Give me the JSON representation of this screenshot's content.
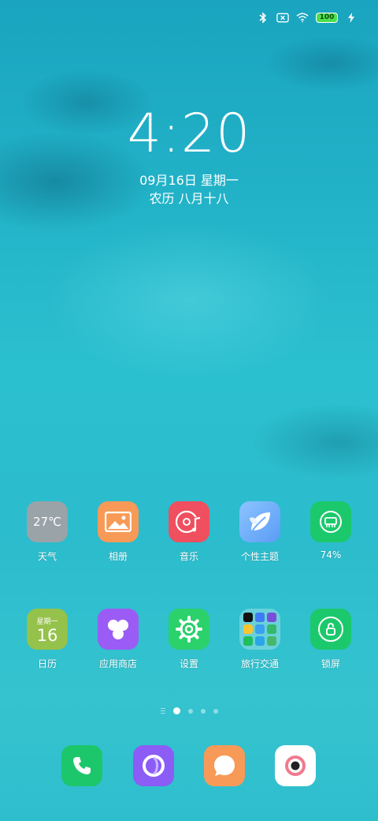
{
  "status": {
    "battery_level": "100",
    "icons": [
      "bluetooth-icon",
      "sim-x-icon",
      "wifi-icon",
      "battery-icon",
      "charging-icon"
    ]
  },
  "lock": {
    "time": "4:20",
    "date": "09月16日 星期一",
    "lunar": "农历 八月十八"
  },
  "row1": [
    {
      "label": "天气",
      "icon": "weather-icon",
      "temp": "27℃"
    },
    {
      "label": "相册",
      "icon": "gallery-icon"
    },
    {
      "label": "音乐",
      "icon": "music-icon"
    },
    {
      "label": "个性主题",
      "icon": "theme-leaf-icon"
    },
    {
      "label": "74%",
      "icon": "storage-cleaner-icon"
    }
  ],
  "row2": [
    {
      "label": "日历",
      "icon": "calendar-icon",
      "weekday": "星期一",
      "day": "16"
    },
    {
      "label": "应用商店",
      "icon": "app-store-icon"
    },
    {
      "label": "设置",
      "icon": "gear-icon"
    },
    {
      "label": "旅行交通",
      "icon": "folder-icon"
    },
    {
      "label": "锁屏",
      "icon": "lock-screen-icon"
    }
  ],
  "pages": {
    "count": 4,
    "active": 1
  },
  "dock": [
    {
      "icon": "phone-icon"
    },
    {
      "icon": "browser-icon"
    },
    {
      "icon": "messages-icon"
    },
    {
      "icon": "camera-icon"
    }
  ],
  "colors": {
    "weather": "#9aa3a8",
    "gallery": "#f79a57",
    "music": "#ef4f5e",
    "theme": "#6aaefc",
    "cleaner": "#1bc96c",
    "calendar": "#95c24a",
    "appstore": "#9a5cf5",
    "settings": "#2bd16b",
    "lockscreen": "#1bc96c",
    "phone": "#1cc76c",
    "browser": "#8b5cf6",
    "messages": "#f79a57",
    "camera": "#ffffff"
  }
}
